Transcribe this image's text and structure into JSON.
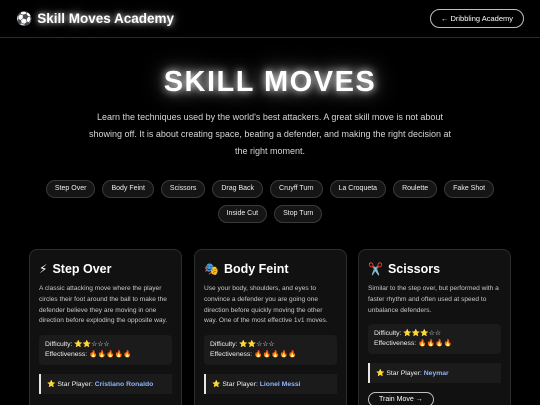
{
  "header": {
    "brand_icon": "⚽",
    "brand_title": "Skill Moves Academy",
    "nav_button": "← Dribbling Academy"
  },
  "hero": {
    "title": "SKILL MOVES",
    "description": "Learn the techniques used by the world's best attackers. A great skill move is not about showing off. It is about creating space, beating a defender, and making the right decision at the right moment."
  },
  "chips": [
    "Step Over",
    "Body Feint",
    "Scissors",
    "Drag Back",
    "Cruyff Turn",
    "La Croqueta",
    "Roulette",
    "Fake Shot",
    "Inside Cut",
    "Stop Turn"
  ],
  "cards": [
    {
      "icon": "⚡",
      "name": "Step Over",
      "description": "A classic attacking move where the player circles their foot around the ball to make the defender believe they are moving in one direction before exploding the opposite way.",
      "difficulty_label": "Difficulty:",
      "difficulty_value": "⭐⭐☆☆☆",
      "effectiveness_label": "Effectiveness:",
      "effectiveness_value": "🔥🔥🔥🔥🔥",
      "star_label": "⭐ Star Player:",
      "star_name": "Cristiano Ronaldo",
      "button": ""
    },
    {
      "icon": "🎭",
      "name": "Body Feint",
      "description": "Use your body, shoulders, and eyes to convince a defender you are going one direction before quickly moving the other way. One of the most effective 1v1 moves.",
      "difficulty_label": "Difficulty:",
      "difficulty_value": "⭐⭐☆☆☆",
      "effectiveness_label": "Effectiveness:",
      "effectiveness_value": "🔥🔥🔥🔥🔥",
      "star_label": "⭐ Star Player:",
      "star_name": "Lionel Messi",
      "button": ""
    },
    {
      "icon": "✂️",
      "name": "Scissors",
      "description": "Similar to the step over, but performed with a faster rhythm and often used at speed to unbalance defenders.",
      "difficulty_label": "Difficulty:",
      "difficulty_value": "⭐⭐⭐☆☆",
      "effectiveness_label": "Effectiveness:",
      "effectiveness_value": "🔥🔥🔥🔥",
      "star_label": "⭐ Star Player:",
      "star_name": "Neymar",
      "button": "Train Move →"
    }
  ]
}
